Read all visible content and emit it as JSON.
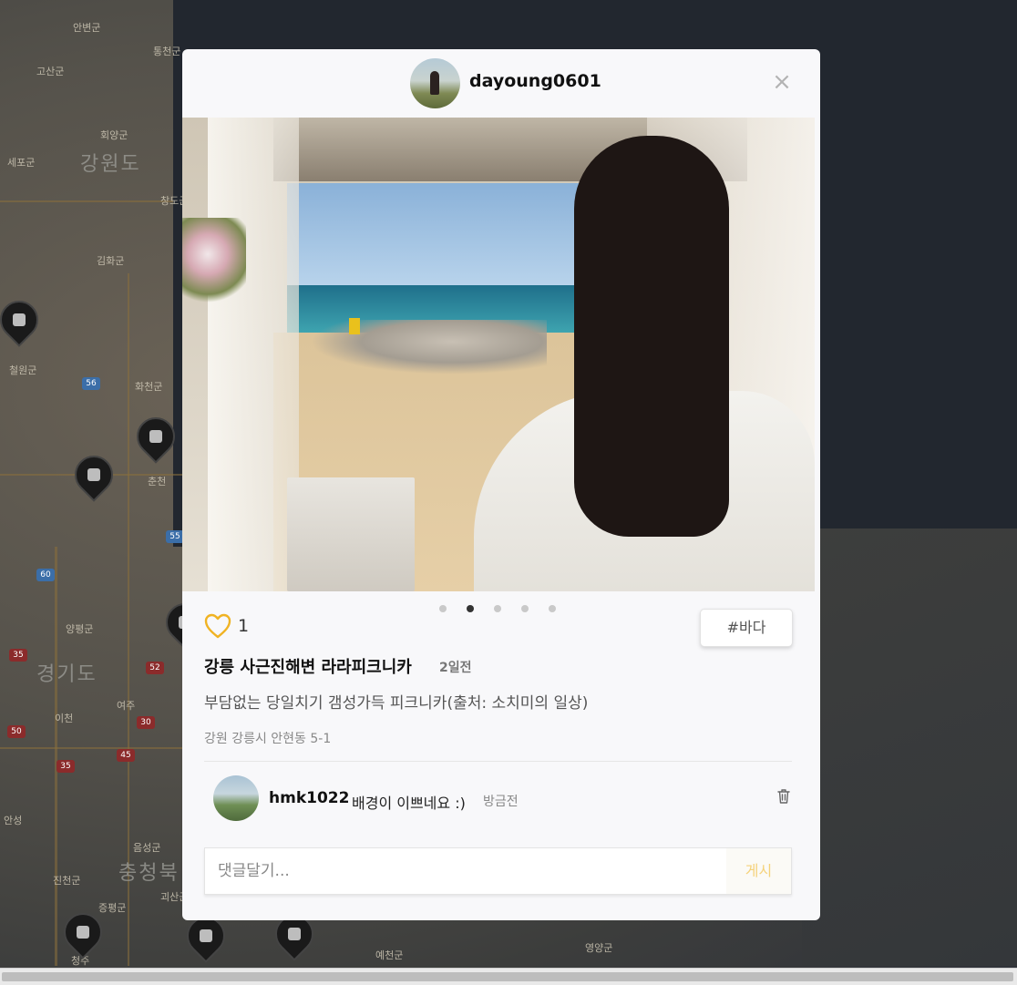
{
  "map": {
    "labels": [
      "안변군",
      "통천군",
      "고산군",
      "회양군",
      "강원도",
      "세포군",
      "창도군",
      "김화군",
      "철원군",
      "화천군",
      "양평군",
      "경기도",
      "여주",
      "이천",
      "안성",
      "음성군",
      "진천군",
      "증평군",
      "괴산군",
      "충청북",
      "청주",
      "예천군",
      "영양군",
      "춘천",
      "증평군"
    ],
    "shields": [
      "56",
      "60",
      "35",
      "52",
      "55",
      "50",
      "45",
      "35",
      "30"
    ]
  },
  "modal": {
    "username": "dayoung0601",
    "close_icon": "×",
    "slides": {
      "count": 5,
      "active": 2
    },
    "likes": "1",
    "tag": "#바다",
    "place_title": "강릉 사근진해변 라라피크니카",
    "post_time": "2일전",
    "description": "부담없는 당일치기 갬성가득 피크니카(출처: 소치미의 일상)",
    "address": "강원 강릉시 안현동 5-1",
    "comment": {
      "user": "hmk1022",
      "text": "배경이 이쁘네요 :)",
      "time": "방금전"
    },
    "comment_input": {
      "placeholder": "댓글달기...",
      "value": ""
    },
    "post_button": "게시"
  },
  "colors": {
    "accent_heart": "#f0b323",
    "post_button": "#f5d27a"
  }
}
